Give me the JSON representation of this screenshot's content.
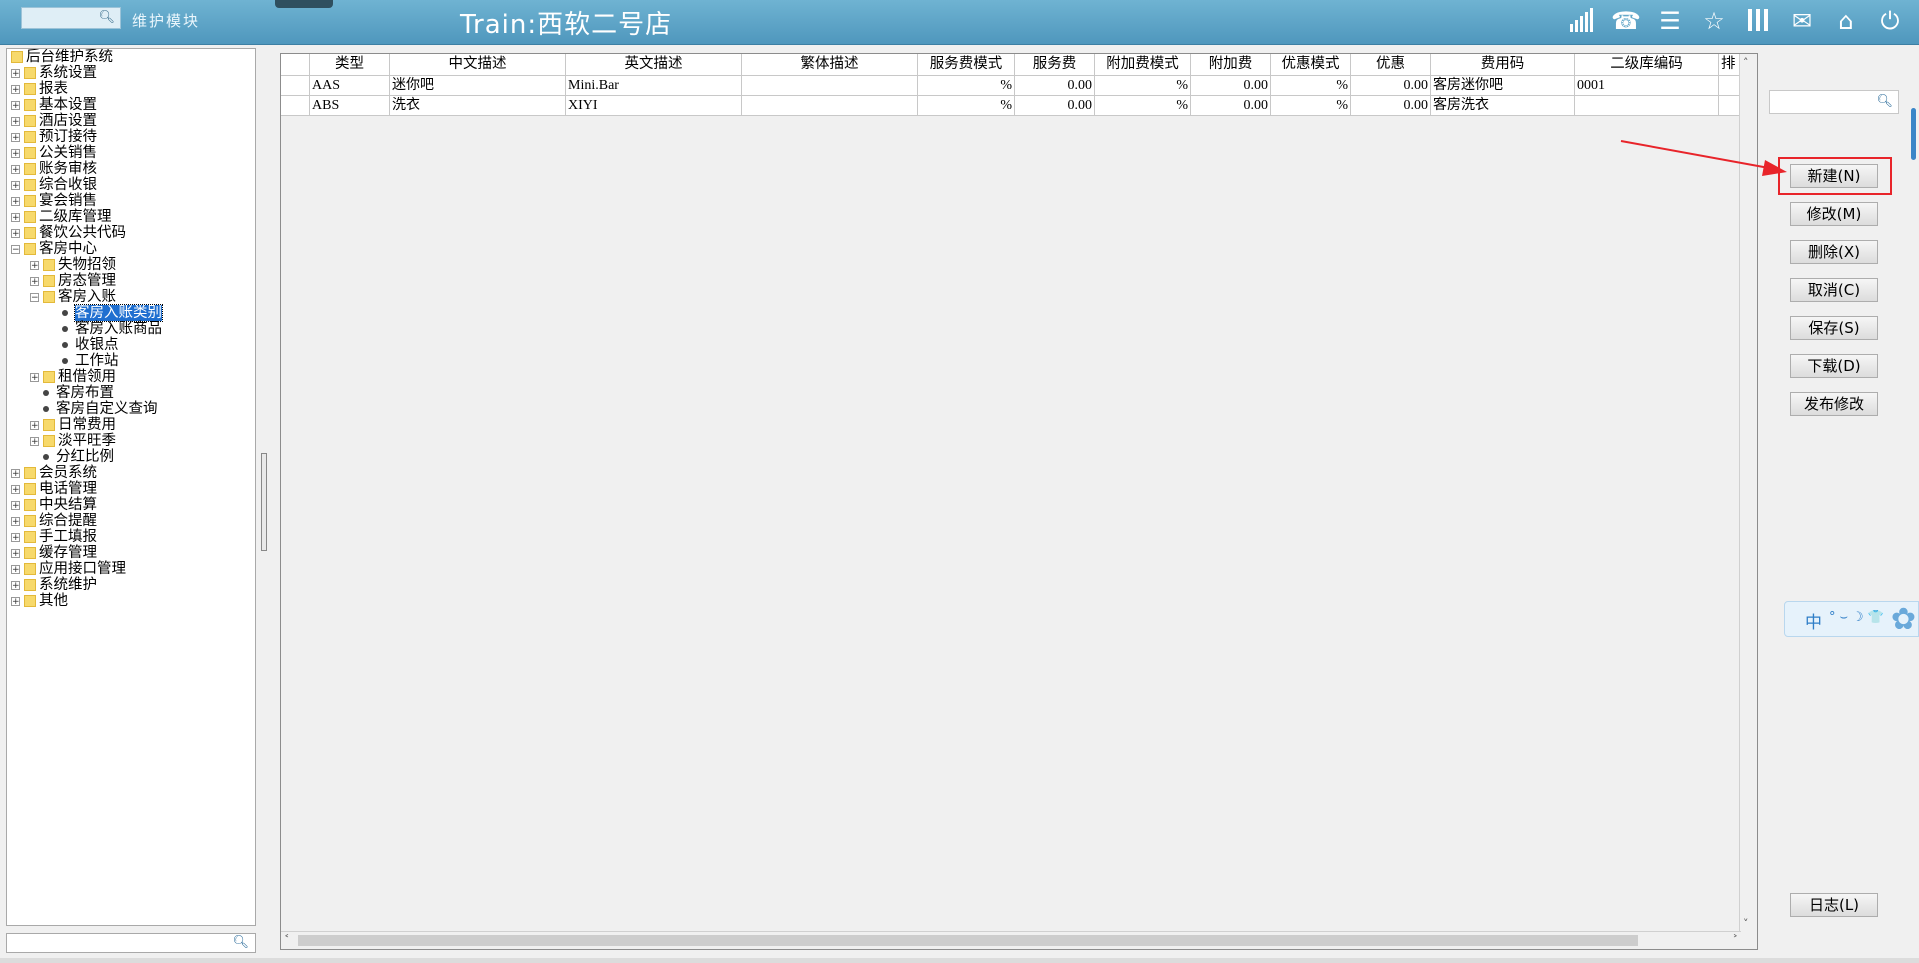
{
  "header": {
    "module_label": "维护模块",
    "title": "Train:西软二号店",
    "icons": [
      "signal-icon",
      "phone-icon",
      "menu-icon",
      "star-icon",
      "columns-icon",
      "mail-icon",
      "home-icon",
      "power-icon"
    ]
  },
  "tree": {
    "root": "后台维护系统",
    "items": {
      "sys_settings": "系统设置",
      "reports": "报表",
      "basic_settings": "基本设置",
      "hotel_settings": "酒店设置",
      "reservation": "预订接待",
      "pr_sales": "公关销售",
      "audit": "账务审核",
      "cashier": "综合收银",
      "banquet": "宴会销售",
      "stock2": "二级库管理",
      "fnb_codes": "餐饮公共代码",
      "housekeeping": "客房中心",
      "lost_found": "失物招领",
      "room_status": "房态管理",
      "room_posting": "客房入账",
      "posting_category": "客房入账类别",
      "posting_goods": "客房入账商品",
      "cash_point": "收银点",
      "workstation": "工作站",
      "borrow": "租借领用",
      "room_layout": "客房布置",
      "custom_query": "客房自定义查询",
      "daily_cost": "日常费用",
      "season": "淡平旺季",
      "dividend": "分红比例",
      "member": "会员系统",
      "telephone": "电话管理",
      "central_settle": "中央结算",
      "reminder": "综合提醒",
      "manual_fill": "手工填报",
      "cache": "缓存管理",
      "api": "应用接口管理",
      "sys_maint": "系统维护",
      "other": "其他"
    }
  },
  "grid": {
    "columns": [
      "类型",
      "中文描述",
      "英文描述",
      "繁体描述",
      "服务费模式",
      "服务费",
      "附加费模式",
      "附加费",
      "优惠模式",
      "优惠",
      "费用码",
      "二级库编码",
      "排"
    ],
    "rows": [
      [
        "AAS",
        "迷你吧",
        "Mini.Bar",
        "",
        "%",
        "0.00",
        "%",
        "0.00",
        "%",
        "0.00",
        "客房迷你吧",
        "0001",
        ""
      ],
      [
        "ABS",
        "洗衣",
        "XIYI",
        "",
        "%",
        "0.00",
        "%",
        "0.00",
        "%",
        "0.00",
        "客房洗衣",
        "",
        ""
      ]
    ]
  },
  "buttons": {
    "new": "新建(N)",
    "modify": "修改(M)",
    "delete": "删除(X)",
    "cancel": "取消(C)",
    "save": "保存(S)",
    "download": "下载(D)",
    "publish": "发布修改",
    "log": "日志(L)"
  },
  "ime": {
    "char": "中",
    "symbols": "°⌣☽👕"
  },
  "colors": {
    "header": "#5aa3c8",
    "selection": "#1f6fd0",
    "highlight": "#e8242a"
  }
}
